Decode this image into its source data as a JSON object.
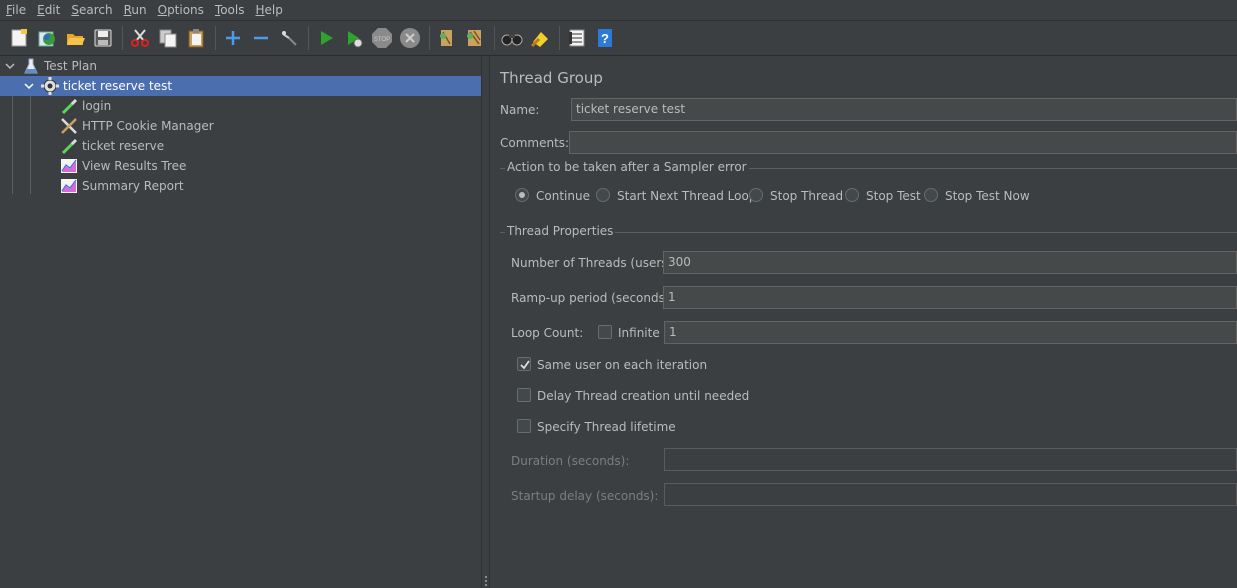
{
  "menu": [
    {
      "key": "F",
      "rest": "ile"
    },
    {
      "key": "E",
      "rest": "dit"
    },
    {
      "key": "S",
      "rest": "earch"
    },
    {
      "key": "R",
      "rest": "un"
    },
    {
      "key": "O",
      "rest": "ptions"
    },
    {
      "key": "T",
      "rest": "ools"
    },
    {
      "key": "H",
      "rest": "elp"
    }
  ],
  "toolbar_icons": [
    "new-icon",
    "templates-icon",
    "open-icon",
    "save-icon",
    "cut-icon",
    "copy-icon",
    "paste-icon",
    "expand-icon",
    "collapse-icon",
    "toggle-icon",
    "start-icon",
    "start-no-pauses-icon",
    "stop-icon",
    "shutdown-icon",
    "clear-icon",
    "clear-all-icon",
    "search-icon",
    "reset-search-icon",
    "function-helper-icon",
    "help-icon"
  ],
  "tree": {
    "root": "Test Plan",
    "thread_group": "ticket reserve test",
    "children": [
      "login",
      "HTTP Cookie Manager",
      "ticket reserve",
      "View Results Tree",
      "Summary Report"
    ]
  },
  "panel": {
    "title": "Thread Group",
    "name_label": "Name:",
    "name_value": "ticket reserve test",
    "comments_label": "Comments:",
    "comments_value": "",
    "sampler_error_title": "Action to be taken after a Sampler error",
    "sampler_error_options": [
      "Continue",
      "Start Next Thread Loop",
      "Stop Thread",
      "Stop Test",
      "Stop Test Now"
    ],
    "sampler_error_selected": "Continue",
    "thread_props_title": "Thread Properties",
    "threads_label": "Number of Threads (users):",
    "threads_value": "300",
    "rampup_label": "Ramp-up period (seconds):",
    "rampup_value": "1",
    "loop_label": "Loop Count:",
    "infinite_label": "Infinite",
    "infinite_checked": false,
    "loop_value": "1",
    "same_user_label": "Same user on each iteration",
    "same_user_checked": true,
    "delay_label": "Delay Thread creation until needed",
    "delay_checked": false,
    "lifetime_label": "Specify Thread lifetime",
    "lifetime_checked": false,
    "duration_label": "Duration (seconds):",
    "duration_value": "",
    "startup_label": "Startup delay (seconds):",
    "startup_value": ""
  },
  "colors": {
    "background": "#3c3f41",
    "selection": "#4b6eaf",
    "field": "#45494a",
    "text": "#bbbbbb"
  }
}
